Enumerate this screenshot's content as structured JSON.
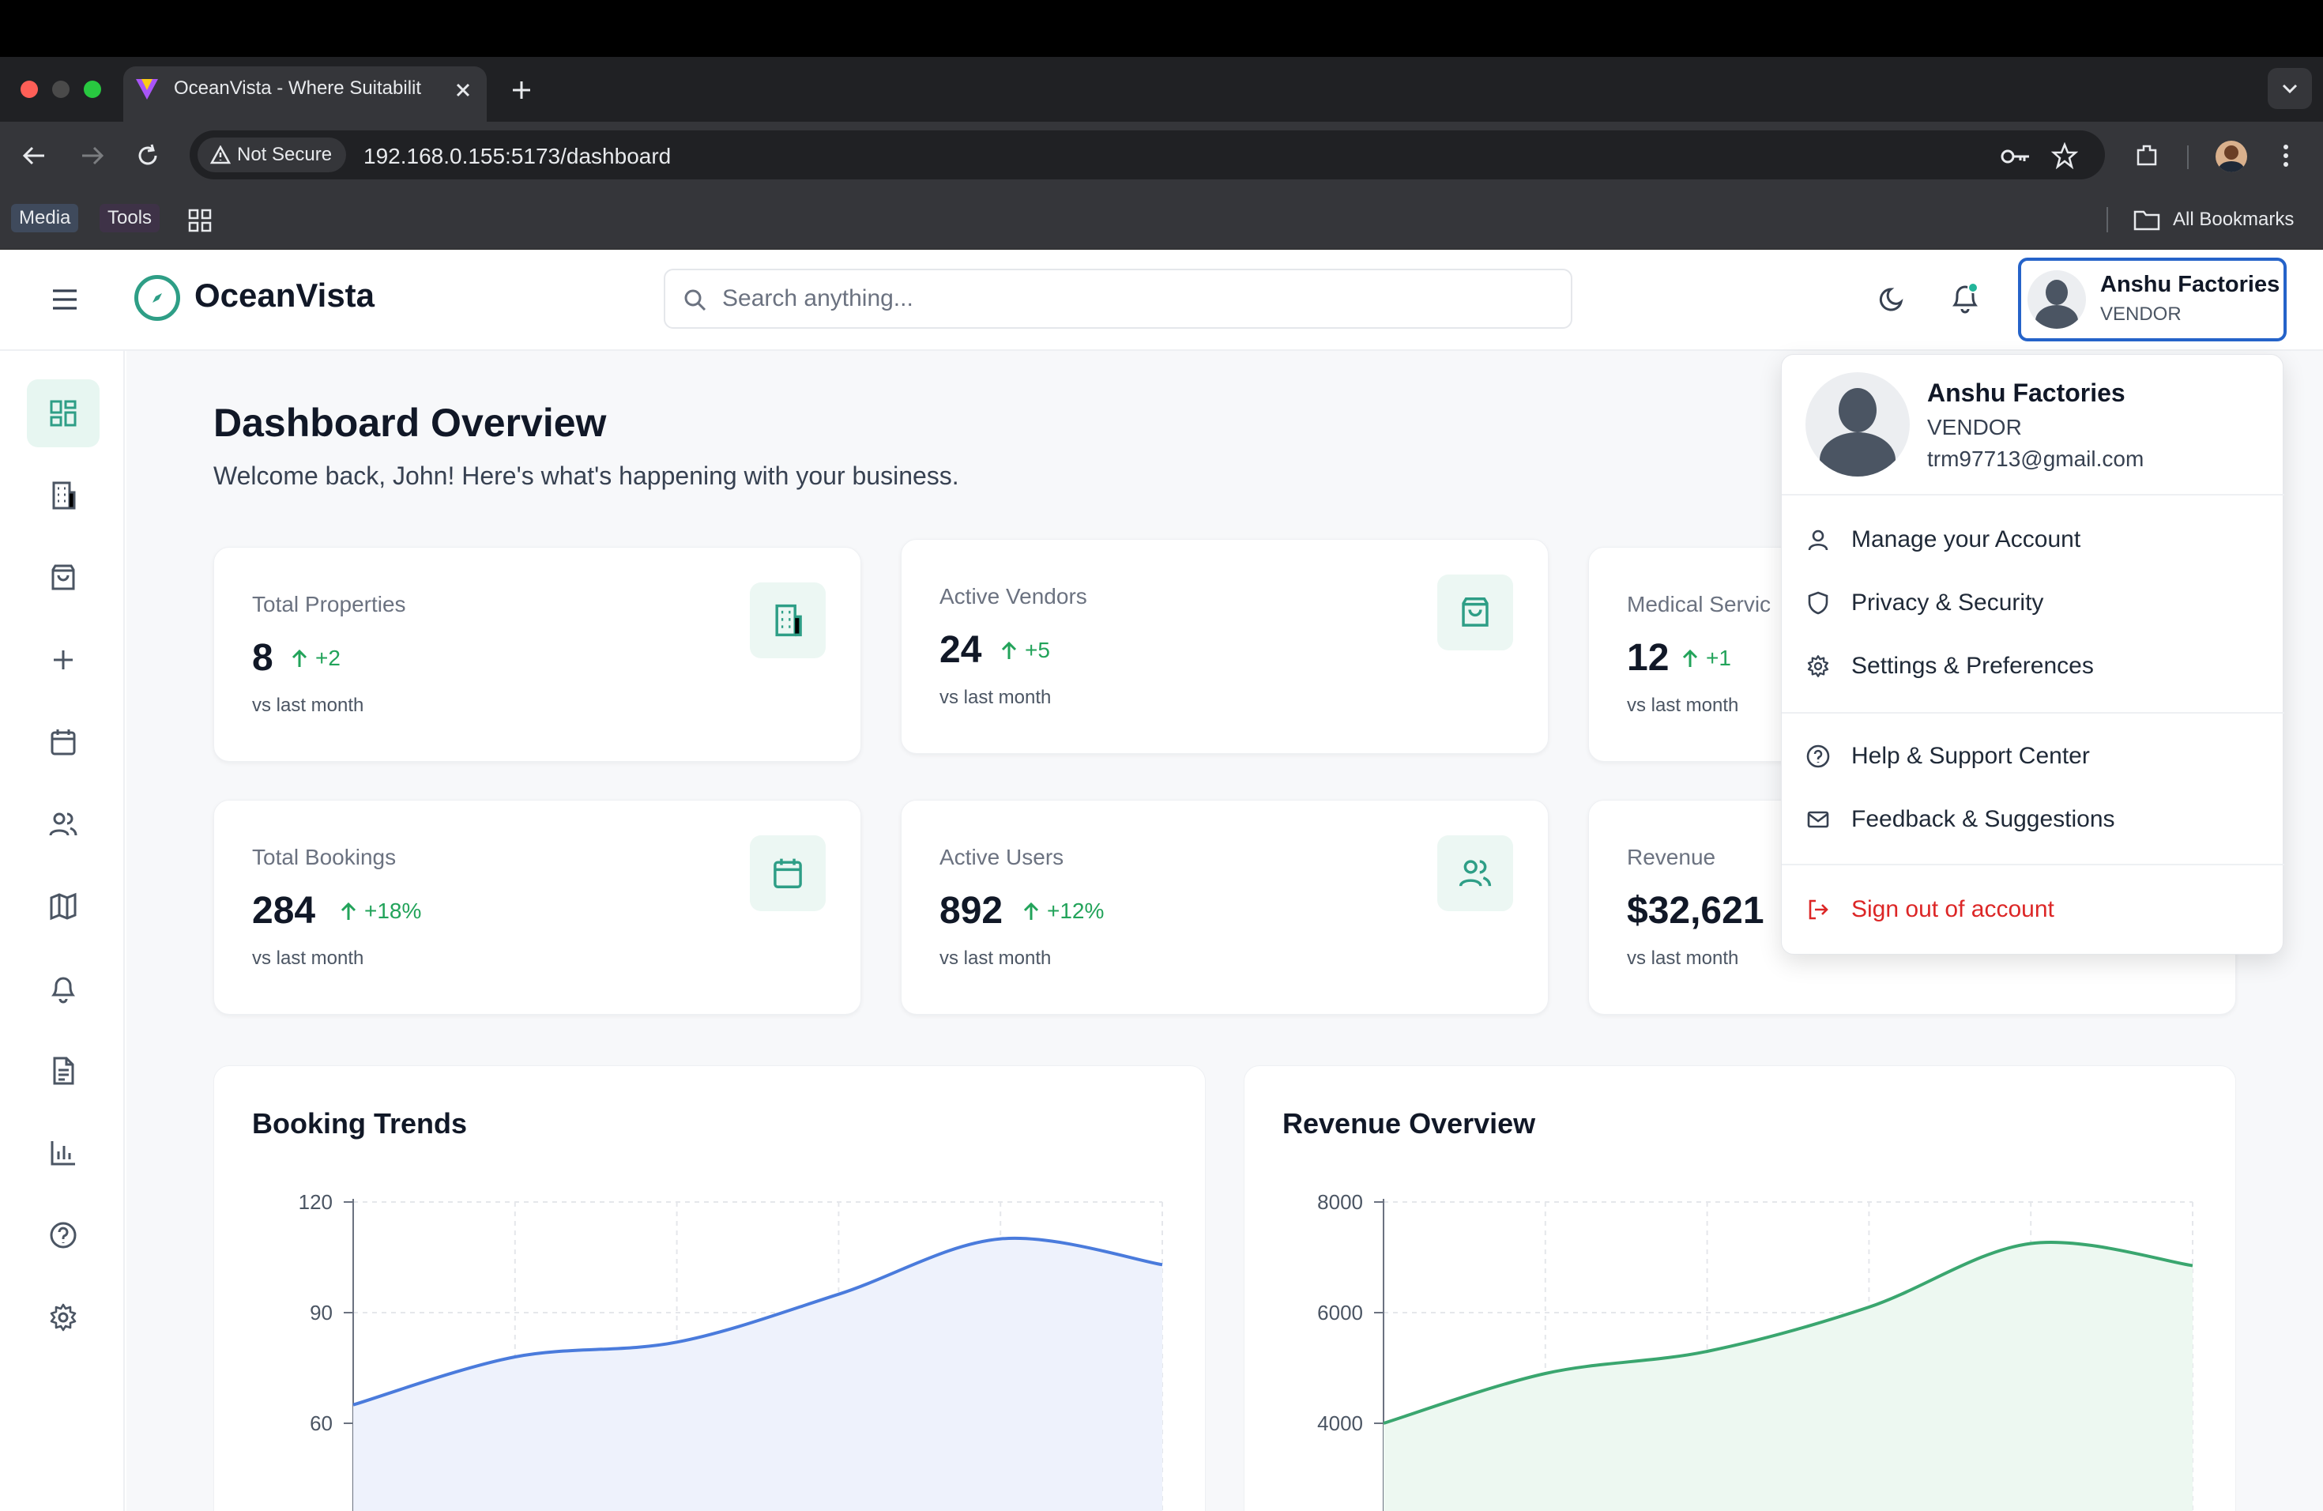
{
  "browser": {
    "tab_title": "OceanVista - Where Suitabilit",
    "security_label": "Not Secure",
    "url": "192.168.0.155:5173/dashboard",
    "bookmarks": [
      "Media",
      "Tools"
    ],
    "all_bookmarks": "All Bookmarks"
  },
  "app": {
    "name": "OceanVista",
    "search_placeholder": "Search anything...",
    "user": {
      "name": "Anshu Factories",
      "role": "VENDOR",
      "email": "trm97713@gmail.com"
    }
  },
  "sidebar": {
    "items": [
      "dashboard-icon",
      "building-icon",
      "shopping-bag-icon",
      "plus-icon",
      "calendar-icon",
      "users-icon",
      "map-icon",
      "bell-icon",
      "document-icon",
      "bar-chart-icon",
      "help-icon",
      "gear-icon"
    ]
  },
  "page": {
    "title": "Dashboard Overview",
    "subtitle": "Welcome back, John! Here's what's happening with your business."
  },
  "stats": [
    {
      "label": "Total Properties",
      "value": "8",
      "delta": "+2",
      "foot": "vs last month",
      "icon": "building-icon"
    },
    {
      "label": "Active Vendors",
      "value": "24",
      "delta": "+5",
      "foot": "vs last month",
      "icon": "shopping-bag-icon"
    },
    {
      "label": "Medical Servic",
      "value": "12",
      "delta": "+1",
      "foot": "vs last month",
      "icon": "plus-icon"
    },
    {
      "label": "Total Bookings",
      "value": "284",
      "delta": "+18%",
      "foot": "vs last month",
      "icon": "calendar-icon"
    },
    {
      "label": "Active Users",
      "value": "892",
      "delta": "+12%",
      "foot": "vs last month",
      "icon": "users-icon"
    },
    {
      "label": "Revenue",
      "value": "$32,621",
      "foot": "vs last month",
      "icon": "trend-icon"
    }
  ],
  "dropdown": {
    "items": [
      {
        "label": "Manage your Account",
        "icon": "user-icon"
      },
      {
        "label": "Privacy & Security",
        "icon": "shield-icon"
      },
      {
        "label": "Settings & Preferences",
        "icon": "gear-icon"
      },
      {
        "label": "Help & Support Center",
        "icon": "help-icon"
      },
      {
        "label": "Feedback & Suggestions",
        "icon": "mail-icon"
      },
      {
        "label": "Sign out of account",
        "icon": "logout-icon"
      }
    ]
  },
  "colors": {
    "accent": "#2e9e86",
    "booking_line": "#4a7bdc",
    "revenue_line": "#3aa66f",
    "danger": "#dc2626",
    "delta": "#22a35a"
  },
  "chart_data": [
    {
      "type": "area",
      "title": "Booking Trends",
      "yticks": [
        60,
        90,
        120
      ],
      "visible_y_range": [
        40,
        120
      ],
      "x": [
        0,
        1,
        2,
        3,
        4,
        5
      ],
      "values": [
        65,
        78,
        82,
        95,
        110,
        103
      ],
      "grid": true
    },
    {
      "type": "area",
      "title": "Revenue Overview",
      "yticks": [
        4000,
        6000,
        8000
      ],
      "visible_y_range": [
        3000,
        8000
      ],
      "x": [
        0,
        1,
        2,
        3,
        4,
        5
      ],
      "values": [
        4000,
        4900,
        5300,
        6100,
        7250,
        6850
      ],
      "grid": true
    }
  ]
}
